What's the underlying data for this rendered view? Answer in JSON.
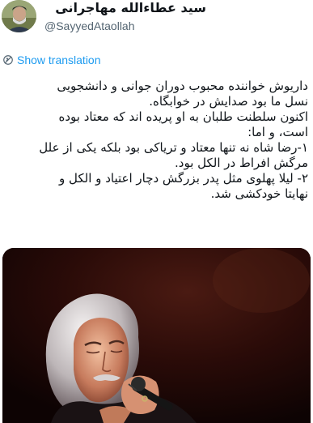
{
  "header": {
    "display_name": "سید عطاءالله مهاجرانی",
    "handle": "@SayyedAtaollah"
  },
  "translate": {
    "label": "Show translation"
  },
  "tweet": {
    "lines": [
      "داریوش خواننده محبوب دوران جوانی و دانشجویی",
      "نسل ما بود صدایش در خوابگاه.",
      "اکنون سلطنت طلبان به او پریده اند که معتاد بوده",
      "است،  و اما:",
      "۱-رضا شاه نه تنها معتاد و تریاکی بود بلکه یکی از علل",
      "مرگش افراط در الکل بود.",
      "۲- لیلا پهلوی مثل پدر بزرگش دچار اعتیاد و الکل و",
      "نهایتا خودکشی شد."
    ]
  },
  "colors": {
    "accent": "#1d9bf0",
    "text": "#0f1419",
    "secondary": "#536471"
  },
  "icons": {
    "translate": "translate-icon",
    "avatar": "avatar",
    "photo": "concert-singer-photo"
  }
}
